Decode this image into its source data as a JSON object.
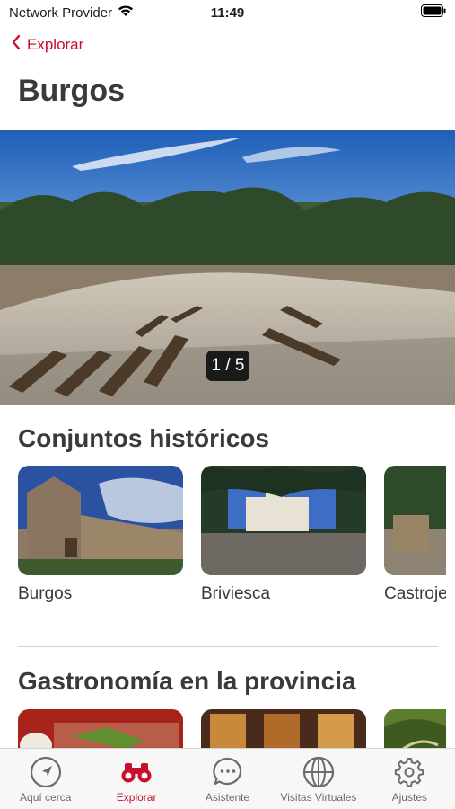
{
  "status_bar": {
    "carrier": "Network Provider",
    "time": "11:49"
  },
  "nav": {
    "back_label": "Explorar"
  },
  "page": {
    "title": "Burgos"
  },
  "hero": {
    "pager": "1 / 5"
  },
  "sections": [
    {
      "title": "Conjuntos históricos",
      "items": [
        {
          "label": "Burgos"
        },
        {
          "label": "Briviesca"
        },
        {
          "label": "Castrojeriz"
        }
      ]
    },
    {
      "title": "Gastronomía en la provincia",
      "items": [
        {
          "label": ""
        },
        {
          "label": ""
        },
        {
          "label": ""
        }
      ]
    }
  ],
  "tab_bar": {
    "items": [
      {
        "label": "Aquí cerca",
        "icon": "location-arrow-icon"
      },
      {
        "label": "Explorar",
        "icon": "binoculars-icon",
        "active": true
      },
      {
        "label": "Asistente",
        "icon": "chat-bubble-icon"
      },
      {
        "label": "Visitas Virtuales",
        "icon": "globe-icon"
      },
      {
        "label": "Ajustes",
        "icon": "gear-icon"
      }
    ]
  },
  "colors": {
    "accent": "#c8102e",
    "inactive": "#6b6b70"
  }
}
